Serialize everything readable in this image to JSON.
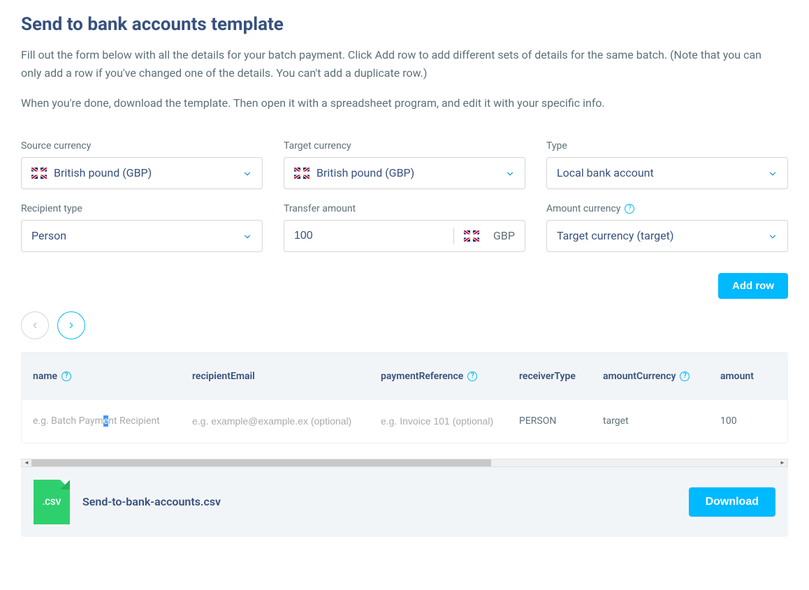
{
  "page": {
    "title": "Send to bank accounts template",
    "desc1": "Fill out the form below with all the details for your batch payment. Click Add row to add different sets of details for the same batch. (Note that you can only add a row if you've changed one of the details. You can't add a duplicate row.)",
    "desc2": "When you're done, download the template. Then open it with a spreadsheet program, and edit it with your specific info."
  },
  "form": {
    "source_currency": {
      "label": "Source currency",
      "value": "British pound (GBP)"
    },
    "target_currency": {
      "label": "Target currency",
      "value": "British pound (GBP)"
    },
    "type": {
      "label": "Type",
      "value": "Local bank account"
    },
    "recipient_type": {
      "label": "Recipient type",
      "value": "Person"
    },
    "transfer_amount": {
      "label": "Transfer amount",
      "value": "100",
      "currency": "GBP"
    },
    "amount_currency": {
      "label": "Amount currency",
      "value": "Target currency (target)"
    }
  },
  "actions": {
    "add_row": "Add row",
    "download": "Download"
  },
  "table": {
    "headers": {
      "name": "name",
      "recipientEmail": "recipientEmail",
      "paymentReference": "paymentReference",
      "receiverType": "receiverType",
      "amountCurrency": "amountCurrency",
      "amount": "amount"
    },
    "row": {
      "name_prefix": "e.g. Batch Paym",
      "name_sel": "e",
      "name_suffix": "nt Recipient",
      "email_placeholder": "e.g. example@example.ex (optional)",
      "reference_placeholder": "e.g. Invoice 101 (optional)",
      "receiverType": "PERSON",
      "amountCurrency": "target",
      "amount": "100"
    }
  },
  "file": {
    "badge": ".CSV",
    "name": "Send-to-bank-accounts.csv"
  }
}
